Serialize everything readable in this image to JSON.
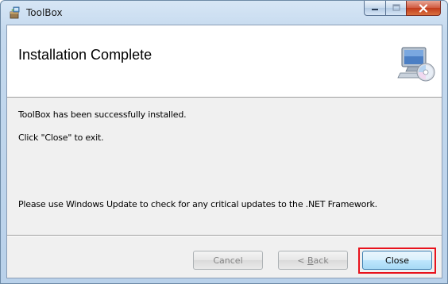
{
  "window": {
    "title": "ToolBox",
    "app_icon": "setup-box-icon",
    "caption_buttons": [
      "minimize",
      "maximize",
      "close"
    ]
  },
  "banner": {
    "title": "Installation Complete",
    "icon": "computer-cd-icon"
  },
  "body": {
    "line1": "ToolBox has been successfully installed.",
    "line2": "Click \"Close\" to exit.",
    "line3": "Please use Windows Update to check for any critical updates to the .NET Framework."
  },
  "buttons": {
    "cancel": "Cancel",
    "back_prefix": "< ",
    "back_accel": "B",
    "back_suffix": "ack",
    "close": "Close"
  },
  "colors": {
    "highlight": "#e8121c",
    "close_button_border": "#3c7fb1"
  }
}
